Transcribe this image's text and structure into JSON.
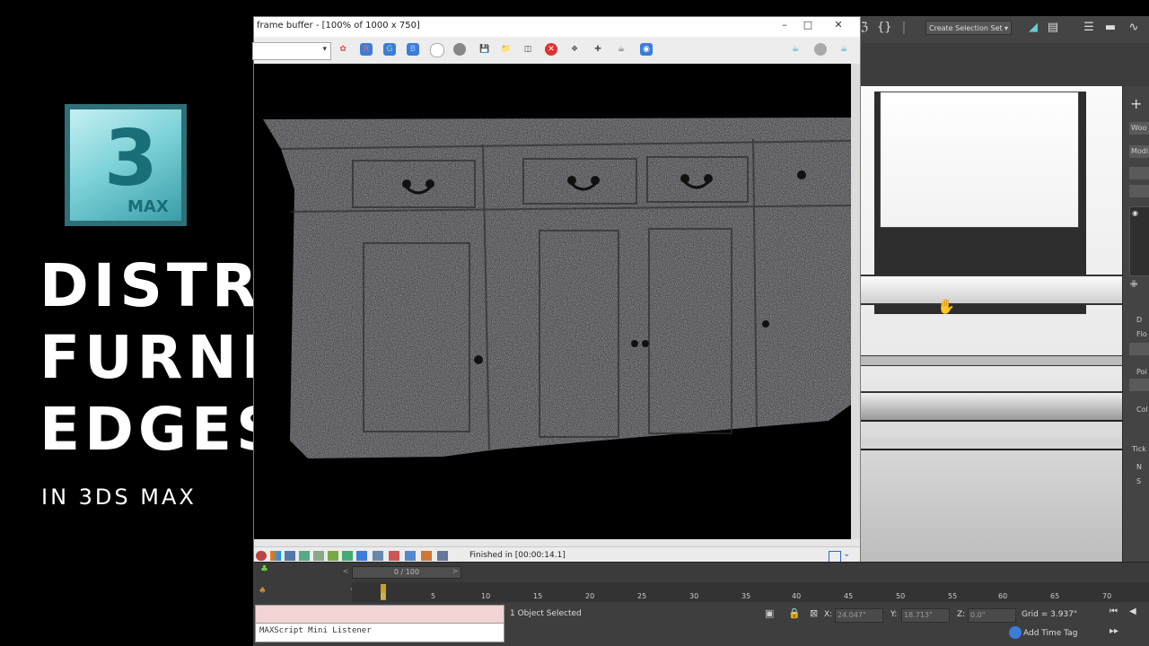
{
  "title": {
    "logo_number": "3",
    "logo_text": "MAX",
    "lines": [
      "DISTRESS",
      "FURNITURE",
      "EDGES"
    ],
    "subtitle": "IN 3DS MAX"
  },
  "frame_buffer": {
    "title": "frame buffer - [100% of 1000 x 750]",
    "channels": [
      "R",
      "G",
      "B"
    ],
    "status": "Finished in [00:00:14.1]"
  },
  "main_toolbar": {
    "selection_set": "Create Selection Set"
  },
  "command_panel": {
    "labels": [
      "Woo",
      "Modi",
      "D",
      "Flo",
      "Poi",
      "Col",
      "Tick",
      "N",
      "S"
    ]
  },
  "timeline": {
    "slider": "0 / 100",
    "ticks": [
      "0",
      "5",
      "10",
      "15",
      "20",
      "25",
      "30",
      "35",
      "40",
      "45",
      "50",
      "55",
      "60",
      "65",
      "70"
    ]
  },
  "status_bar": {
    "maxscript_label": "MAXScript Mini Listener",
    "selection": "1 Object Selected",
    "x_label": "X:",
    "x_value": "24.047\"",
    "y_label": "Y:",
    "y_value": "18.713\"",
    "z_label": "Z:",
    "z_value": "0.0\"",
    "grid": "Grid = 3.937\"",
    "time_tag": "Add Time Tag"
  },
  "colors": {
    "ui_dark": "#3e3e3e",
    "accent_blue": "#3b7dd8",
    "logo_teal": "#2e6f78"
  }
}
